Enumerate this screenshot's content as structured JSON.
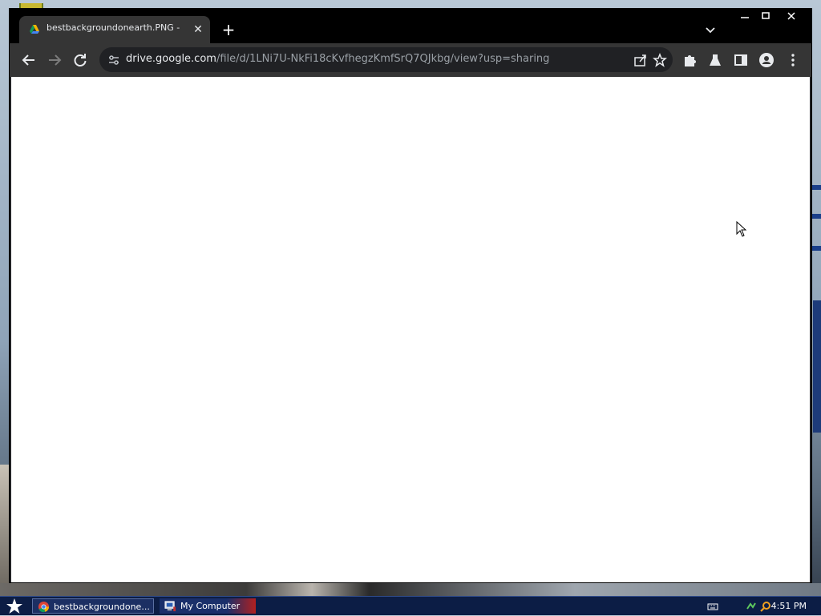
{
  "browser": {
    "tab": {
      "title": "bestbackgroundonearth.PNG - Goo",
      "close_label": "✕"
    },
    "new_tab_label": "+",
    "omnibox": {
      "host": "drive.google.com",
      "path": "/file/d/1LNi7U-NkFi18cKvfhegzKmfSrQ7QJkbg/view?usp=sharing"
    },
    "colors": {
      "titlebar": "#000000",
      "toolbar": "#353535",
      "omnibox": "#202124",
      "content": "#ffffff"
    }
  },
  "taskbar": {
    "items": [
      {
        "label": "bestbackgroundone...",
        "icon": "chrome-icon",
        "active": true
      },
      {
        "label": "My Computer",
        "icon": "my-computer-icon",
        "active": false
      }
    ],
    "clock": "4:51 PM"
  }
}
